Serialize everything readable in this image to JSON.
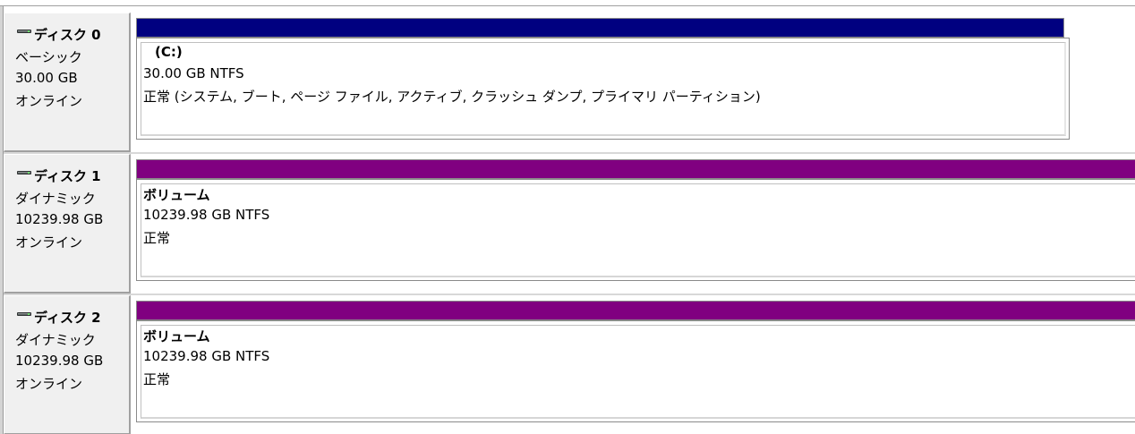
{
  "disks": [
    {
      "name": "ディスク 0",
      "type": "ベーシック",
      "size": "30.00 GB",
      "status": "オンライン",
      "partition": {
        "bar_color": "#000080",
        "name": "(C:)",
        "size_fs": "30.00 GB NTFS",
        "status": "正常 (システム, ブート, ページ ファイル, アクティブ, クラッシュ ダンプ, プライマリ パーティション)"
      }
    },
    {
      "name": "ディスク 1",
      "type": "ダイナミック",
      "size": "10239.98 GB",
      "status": "オンライン",
      "partition": {
        "bar_color": "#800080",
        "name": "ボリューム",
        "size_fs": "10239.98 GB NTFS",
        "status": "正常"
      }
    },
    {
      "name": "ディスク 2",
      "type": "ダイナミック",
      "size": "10239.98 GB",
      "status": "オンライン",
      "partition": {
        "bar_color": "#800080",
        "name": "ボリューム",
        "size_fs": "10239.98 GB NTFS",
        "status": "正常"
      }
    }
  ],
  "icons": {
    "disk": "hard-disk-icon"
  }
}
